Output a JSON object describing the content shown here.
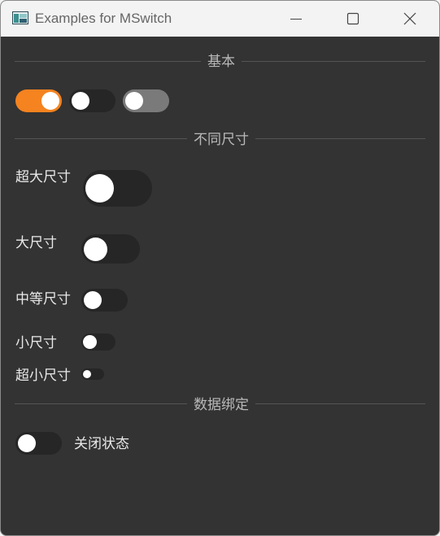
{
  "window": {
    "title": "Examples for MSwitch"
  },
  "sections": {
    "basic": "基本",
    "sizes": "不同尺寸",
    "binding": "数据绑定"
  },
  "basic_switches": [
    {
      "state": "on"
    },
    {
      "state": "off"
    },
    {
      "state": "off-disabled"
    }
  ],
  "size_rows": [
    {
      "label": "超大尺寸",
      "state": "off"
    },
    {
      "label": "大尺寸",
      "state": "off"
    },
    {
      "label": "中等尺寸",
      "state": "off"
    },
    {
      "label": "小尺寸",
      "state": "off"
    },
    {
      "label": "超小尺寸",
      "state": "off"
    }
  ],
  "binding": {
    "switch_state": "off",
    "status_text": "关闭状态"
  },
  "colors": {
    "accent": "#f5831f",
    "background": "#333333",
    "track_off": "#262626",
    "track_disabled": "#7a7a7a"
  }
}
